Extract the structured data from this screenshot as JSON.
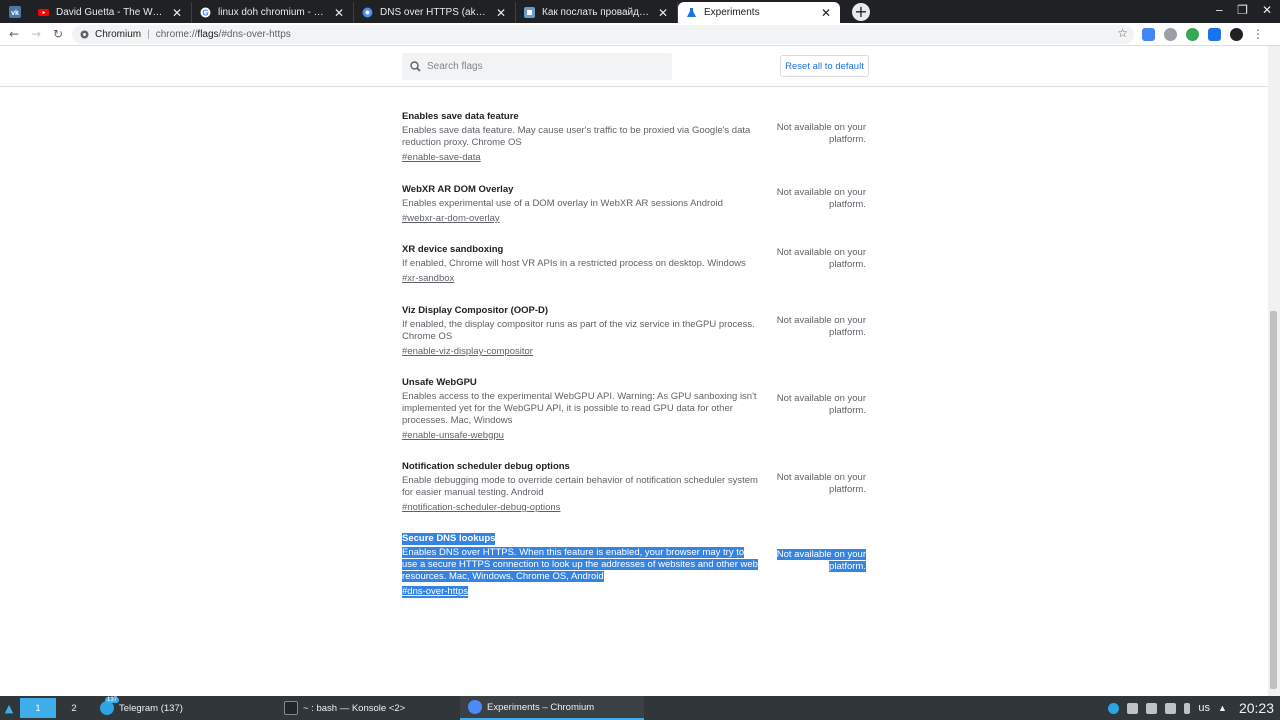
{
  "browser": {
    "tabs": [
      {
        "title": "David Guetta - The World Is M",
        "favicon": "youtube-icon",
        "color": "#ff0000"
      },
      {
        "title": "linux doh chromium - Поиск в",
        "favicon": "google-icon",
        "color": "#4285f4"
      },
      {
        "title": "DNS over HTTPS (aka DoH) - T",
        "favicon": "chromium-icon",
        "color": "#4c8bf5"
      },
      {
        "title": "Как послать провайдера по",
        "favicon": "habr-icon",
        "color": "#6b9ac4"
      },
      {
        "title": "Experiments",
        "favicon": "flask-icon",
        "color": "#1a73e8"
      }
    ],
    "pinned_tab_icon": "vk-icon",
    "omnibox": {
      "site": "Chromium",
      "separator": "|",
      "url_prefix": "chrome://",
      "url_host": "flags",
      "url_suffix": "/#dns-over-https"
    }
  },
  "flags_page": {
    "search_placeholder": "Search flags",
    "reset_label": "Reset all to default",
    "flags": [
      {
        "name": "Enables save data feature",
        "description": "Enables save data feature. May cause user's traffic to be proxied via Google's data reduction proxy. Chrome OS",
        "link": "#enable-save-data",
        "status": "Not available on your platform."
      },
      {
        "name": "WebXR AR DOM Overlay",
        "description": "Enables experimental use of a DOM overlay in WebXR AR sessions Android",
        "link": "#webxr-ar-dom-overlay",
        "status": "Not available on your platform."
      },
      {
        "name": "XR device sandboxing",
        "description": "If enabled, Chrome will host VR APIs in a restricted process on desktop. Windows",
        "link": "#xr-sandbox",
        "status": "Not available on your platform."
      },
      {
        "name": "Viz Display Compositor (OOP-D)",
        "description": "If enabled, the display compositor runs as part of the viz service in theGPU process. Chrome OS",
        "link": "#enable-viz-display-compositor",
        "status": "Not available on your platform."
      },
      {
        "name": "Unsafe WebGPU",
        "description": "Enables access to the experimental WebGPU API. Warning: As GPU sanboxing isn't implemented yet for the WebGPU API, it is possible to read GPU data for other processes. Mac, Windows",
        "link": "#enable-unsafe-webgpu",
        "status": "Not available on your platform."
      },
      {
        "name": "Notification scheduler debug options",
        "description": "Enable debugging mode to override certain behavior of notification scheduler system for easier manual testing. Android",
        "link": "#notification-scheduler-debug-options",
        "status": "Not available on your platform."
      },
      {
        "name": "Secure DNS lookups",
        "description": "Enables DNS over HTTPS. When this feature is enabled, your browser may try to use a secure HTTPS connection to look up the addresses of websites and other web resources. Mac, Windows, Chrome OS, Android",
        "link": "#dns-over-https",
        "status": "Not available on your platform."
      }
    ]
  },
  "taskbar": {
    "desktops": [
      "1",
      "2"
    ],
    "tasks": [
      {
        "label": "Telegram (137)",
        "badge": "137",
        "icon": "telegram-icon"
      },
      {
        "label": "~ : bash — Konsole <2>",
        "icon": "konsole-icon"
      },
      {
        "label": "Experiments – Chromium",
        "icon": "chromium-icon"
      }
    ],
    "lang": "us",
    "clock": "20:23"
  }
}
